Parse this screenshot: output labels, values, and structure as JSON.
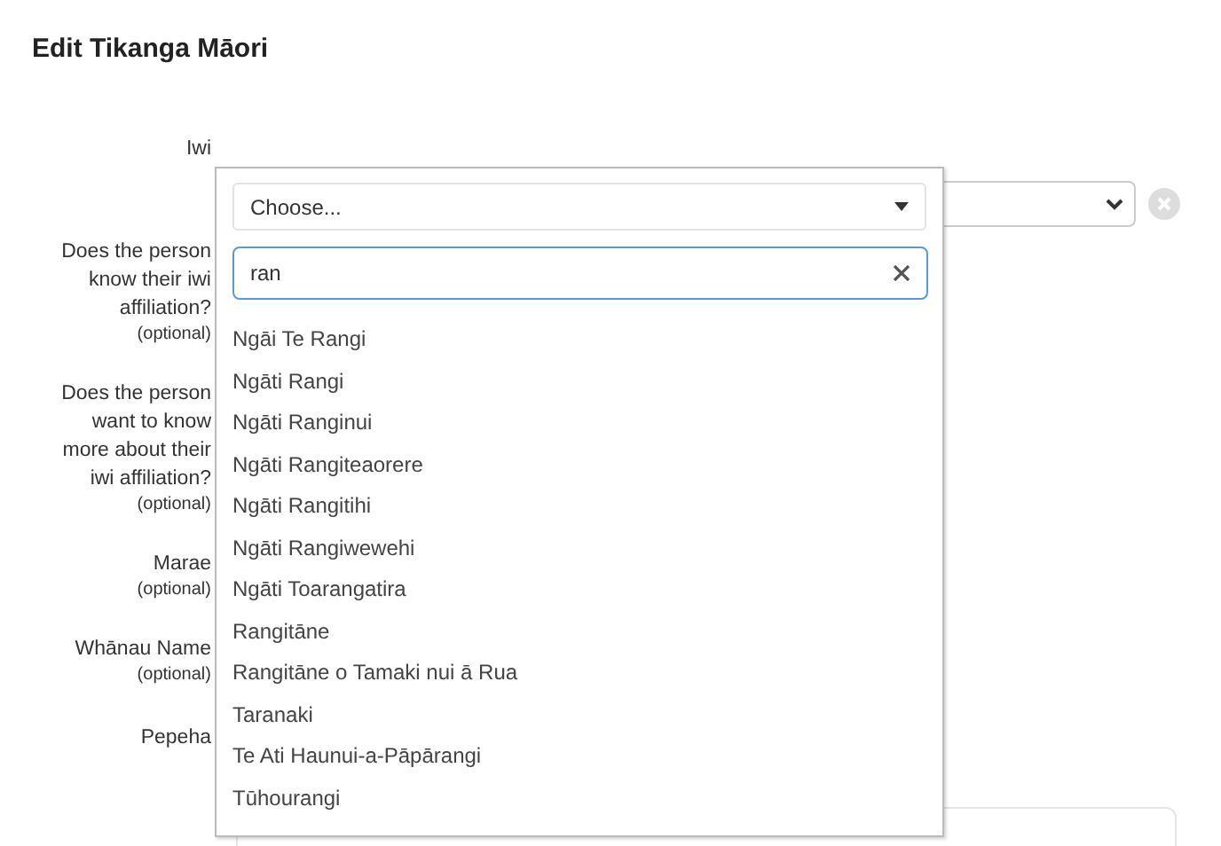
{
  "title": "Edit Tikanga Māori",
  "fields": [
    {
      "label": "Iwi"
    },
    {
      "label": "Does the person know their iwi affiliation?",
      "optional": "(optional)"
    },
    {
      "label": "Does the person want to know more about their iwi affiliation?",
      "optional": "(optional)"
    },
    {
      "label": "Marae",
      "optional": "(optional)"
    },
    {
      "label": "Whānau Name",
      "optional": "(optional)"
    },
    {
      "label": "Pepeha"
    }
  ],
  "dropdown": {
    "selected_text": "Choose...",
    "search_value": "ran",
    "options": [
      {
        "label": "Ngāi Te Rangi"
      },
      {
        "label": "Ngāti Rangi"
      },
      {
        "label": "Ngāti Ranginui"
      },
      {
        "label": "Ngāti Rangiteaorere"
      },
      {
        "label": "Ngāti Rangitihi"
      },
      {
        "label": "Ngāti Rangiwewehi"
      },
      {
        "label": "Ngāti Toarangatira"
      },
      {
        "label": "Rangitāne"
      },
      {
        "label": "Rangitāne o Tamaki nui ā Rua"
      },
      {
        "label": "Taranaki"
      },
      {
        "label": "Te Ati Haunui-a-Pāpārangi"
      },
      {
        "label": "Tūhourangi"
      }
    ]
  }
}
